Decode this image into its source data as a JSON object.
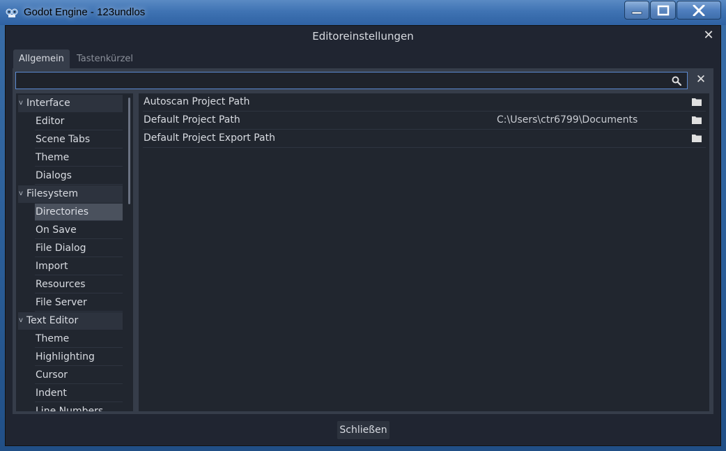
{
  "window": {
    "title": "Godot Engine - 123undlos",
    "buttons": [
      "minimize",
      "maximize",
      "close"
    ]
  },
  "dialog": {
    "title": "Editoreinstellungen",
    "close_icon": "close-icon"
  },
  "tabs": [
    {
      "label": "Allgemein",
      "active": true
    },
    {
      "label": "Tastenkürzel",
      "active": false
    }
  ],
  "search": {
    "value": "",
    "placeholder": ""
  },
  "tree": {
    "categories": [
      {
        "label": "Interface",
        "items": [
          "Editor",
          "Scene Tabs",
          "Theme",
          "Dialogs"
        ]
      },
      {
        "label": "Filesystem",
        "items": [
          "Directories",
          "On Save",
          "File Dialog",
          "Import",
          "Resources",
          "File Server"
        ]
      },
      {
        "label": "Text Editor",
        "items": [
          "Theme",
          "Highlighting",
          "Cursor",
          "Indent",
          "Line Numbers"
        ]
      }
    ],
    "selected": "Directories"
  },
  "properties": [
    {
      "label": "Autoscan Project Path",
      "value": ""
    },
    {
      "label": "Default Project Path",
      "value": "C:\\Users\\ctr6799\\Documents"
    },
    {
      "label": "Default Project Export Path",
      "value": ""
    }
  ],
  "footer": {
    "close_label": "Schließen"
  },
  "colors": {
    "background": "#202531",
    "panel": "#363d4a",
    "tree_bg": "#21262f",
    "selected": "#4a515d",
    "accent": "#5c8ad0",
    "text": "#d9dce2"
  }
}
